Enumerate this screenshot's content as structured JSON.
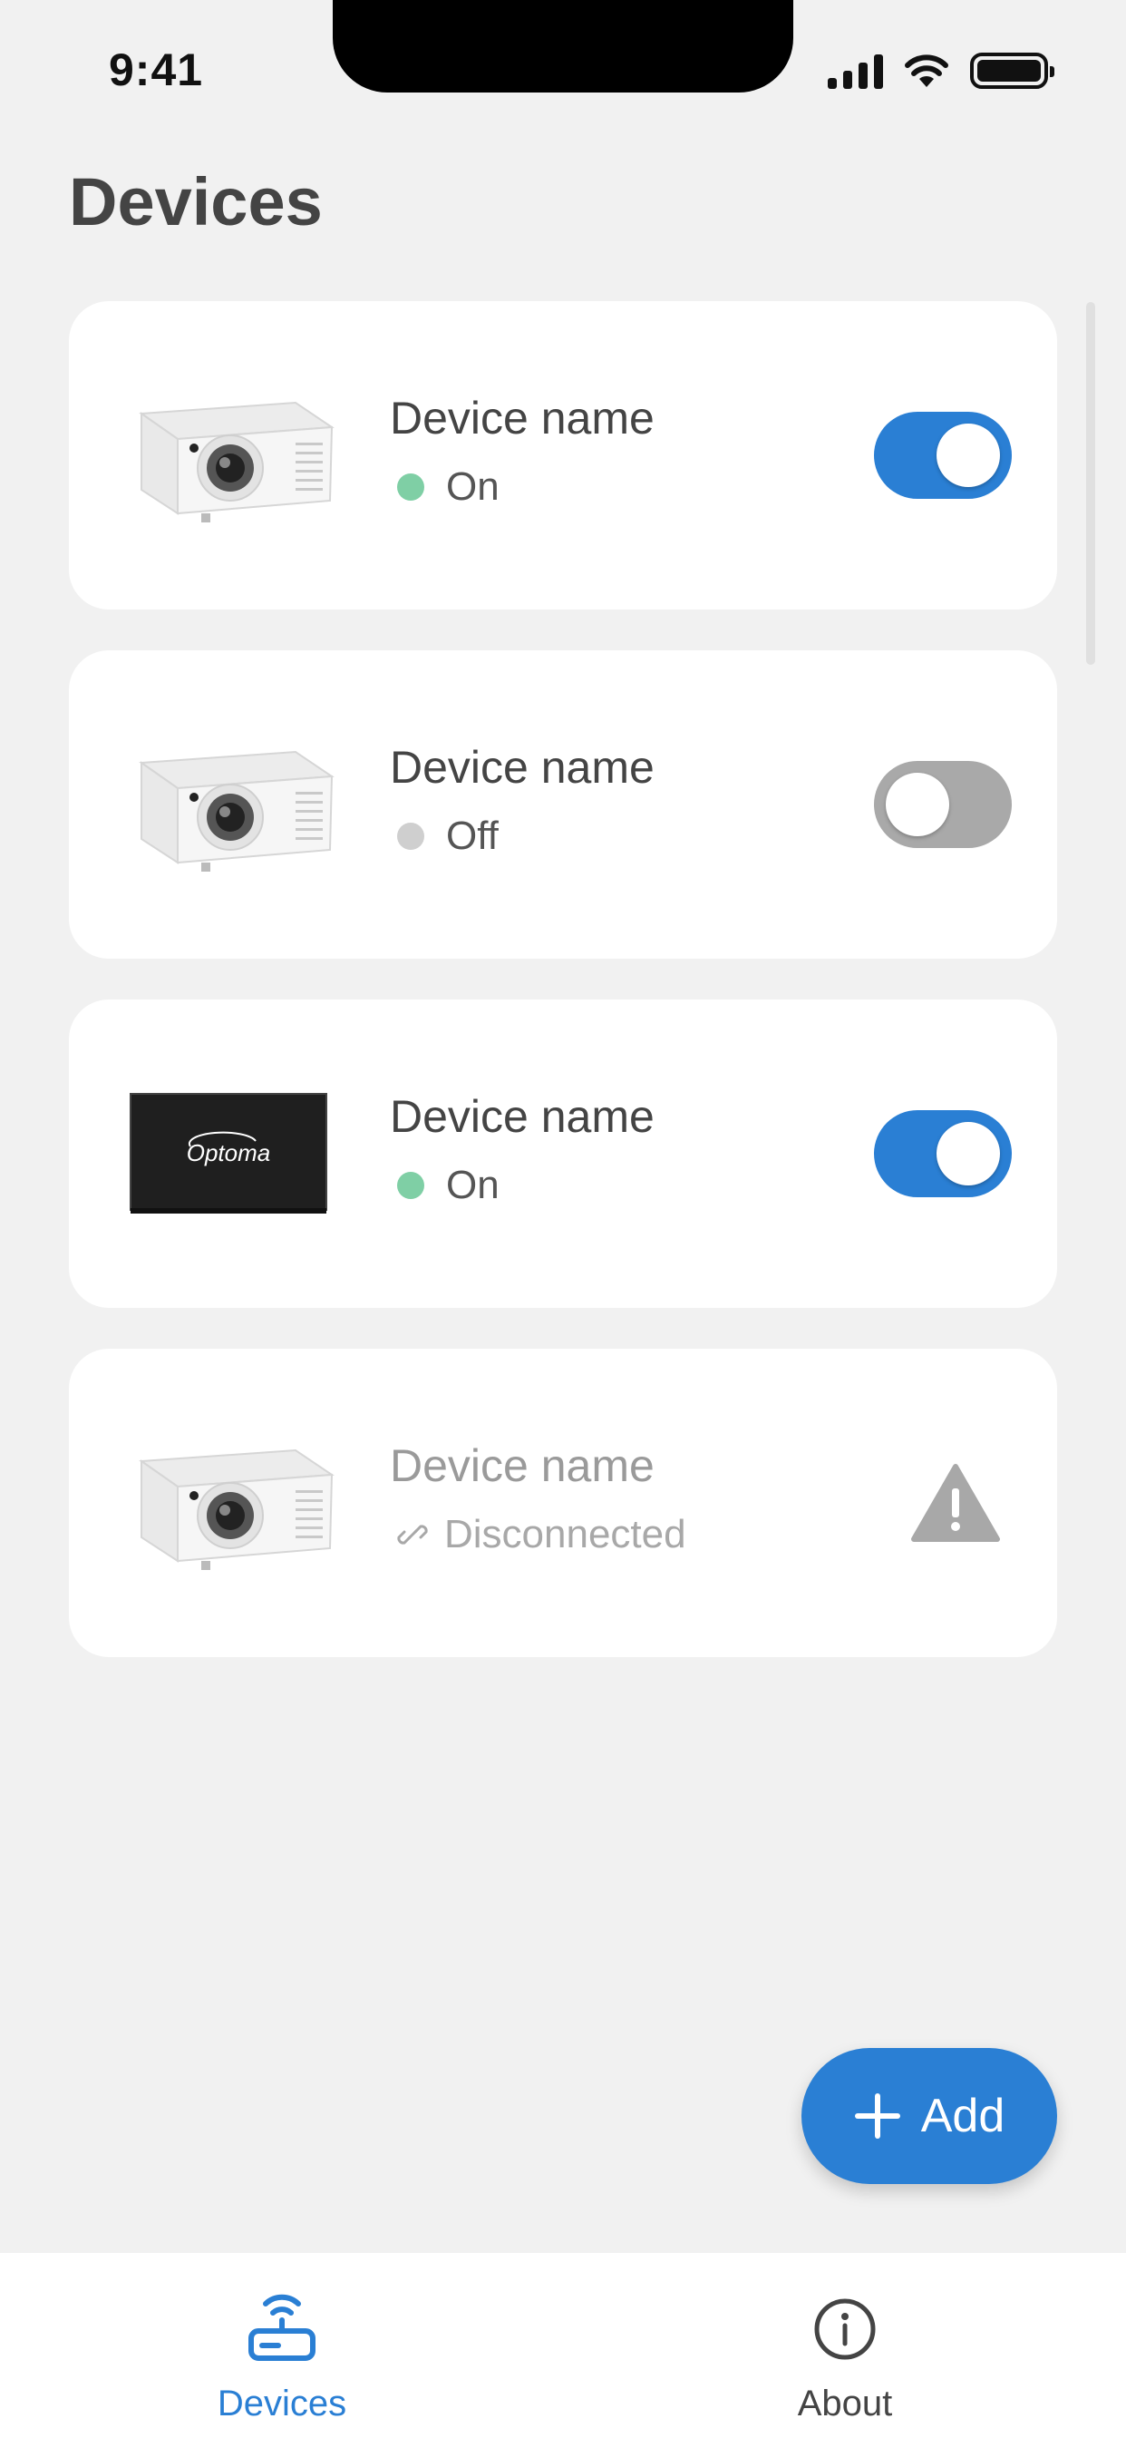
{
  "status_bar": {
    "time": "9:41"
  },
  "header": {
    "title": "Devices"
  },
  "colors": {
    "accent": "#2a7fd4",
    "status_on": "#7fcfa5",
    "status_off": "#cfcfcf",
    "toggle_off": "#a9a9a9",
    "warning": "#a8a8a8"
  },
  "devices": [
    {
      "name": "Device name",
      "status": "On",
      "type": "projector",
      "toggle": "on"
    },
    {
      "name": "Device name",
      "status": "Off",
      "type": "projector",
      "toggle": "off"
    },
    {
      "name": "Device name",
      "status": "On",
      "type": "display",
      "brand": "Optoma",
      "toggle": "on"
    },
    {
      "name": "Device name",
      "status": "Disconnected",
      "type": "projector",
      "toggle": null
    }
  ],
  "add_button": {
    "label": "Add",
    "icon": "plus-icon"
  },
  "tabs": [
    {
      "label": "Devices",
      "icon": "router-wifi-icon",
      "active": true
    },
    {
      "label": "About",
      "icon": "info-icon",
      "active": false
    }
  ]
}
